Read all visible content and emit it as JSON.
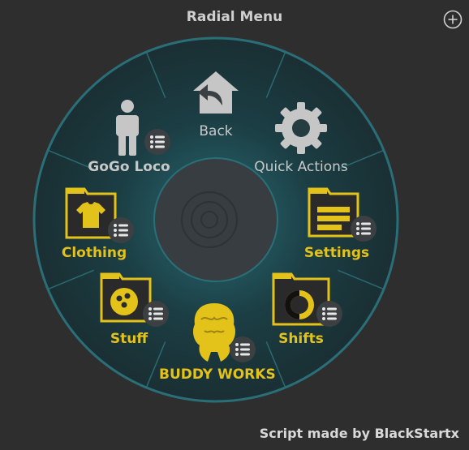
{
  "window": {
    "title": "Radial Menu",
    "add_icon": "plus-circle-icon"
  },
  "menu": {
    "items": [
      {
        "id": "back",
        "label": "Back",
        "icon": "home-back-arrow-icon",
        "style": "gray",
        "has_submenu": false
      },
      {
        "id": "quick-actions",
        "label": "Quick Actions",
        "icon": "gear-icon",
        "style": "gray",
        "has_submenu": false
      },
      {
        "id": "settings",
        "label": "Settings",
        "icon": "folder-settings-icon",
        "style": "gold",
        "has_submenu": true
      },
      {
        "id": "shifts",
        "label": "Shifts",
        "icon": "folder-shifts-icon",
        "style": "gold",
        "has_submenu": true
      },
      {
        "id": "buddy-works",
        "label": "BUDDY WORKS",
        "icon": "buddy-works-logo-icon",
        "style": "gold",
        "has_submenu": true
      },
      {
        "id": "stuff",
        "label": "Stuff",
        "icon": "folder-ball-icon",
        "style": "gold",
        "has_submenu": true
      },
      {
        "id": "clothing",
        "label": "Clothing",
        "icon": "folder-shirt-icon",
        "style": "gold",
        "has_submenu": true
      },
      {
        "id": "gogo-loco",
        "label": "GoGo Loco",
        "icon": "person-icon",
        "style": "gray",
        "has_submenu": true
      }
    ],
    "center_icon": "radial-center-icon"
  },
  "colors": {
    "background": "#2e2e2e",
    "ring": "#1f3a3f",
    "ring_border": "#2a6f78",
    "gold": "#e3c21a",
    "gray_label": "#c8c8c8"
  },
  "footer": {
    "credit": "Script made by BlackStartx"
  }
}
